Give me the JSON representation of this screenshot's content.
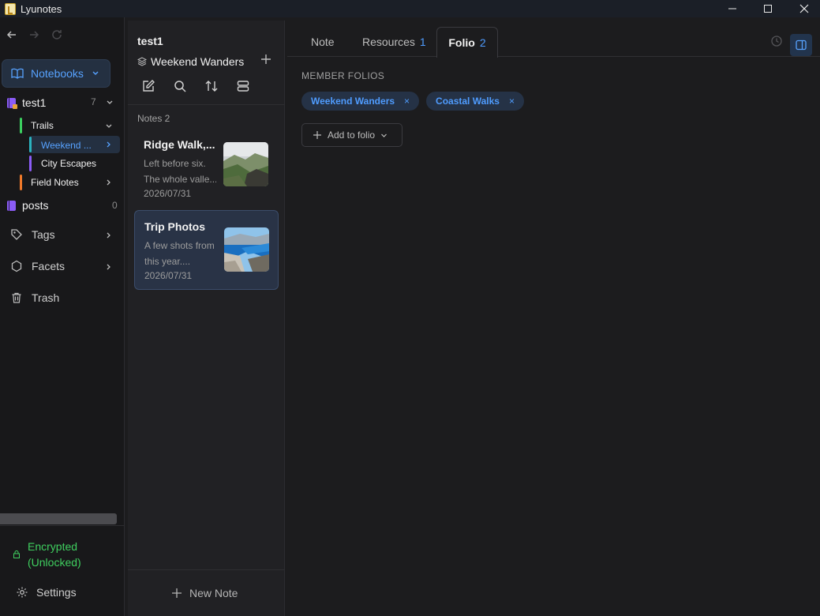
{
  "window": {
    "title": "Lyunotes"
  },
  "sidebar": {
    "notebooks_label": "Notebooks",
    "tree": [
      {
        "label": "test1",
        "count": "7"
      },
      {
        "label": "Trails"
      },
      {
        "label": "Weekend ..."
      },
      {
        "label": "City Escapes"
      },
      {
        "label": "Field Notes"
      },
      {
        "label": "posts",
        "count": "0"
      }
    ],
    "items": [
      {
        "label": "Tags"
      },
      {
        "label": "Facets"
      },
      {
        "label": "Trash"
      }
    ],
    "encrypted_line1": "Encrypted",
    "encrypted_line2": "(Unlocked)",
    "settings_label": "Settings",
    "colors": {
      "accent": "#57a2ff",
      "green": "#3fcf5f",
      "teal": "#2bb3c0",
      "purple": "#8b5cf6",
      "orange": "#f07a2a",
      "lime": "#3ccf5f"
    }
  },
  "notelist": {
    "title": "test1",
    "folio": "Weekend Wanders",
    "notes_label": "Notes 2",
    "notes": [
      {
        "title": "Ridge Walk,...",
        "snippet1": "Left before six.",
        "snippet2": "The whole valle...",
        "date": "2026/07/31"
      },
      {
        "title": "Trip Photos",
        "snippet1": "A few shots from",
        "snippet2": "this year....",
        "date": "2026/07/31"
      }
    ],
    "new_note_label": "New Note"
  },
  "main": {
    "tabs": [
      {
        "label": "Note",
        "count": ""
      },
      {
        "label": "Resources",
        "count": "1"
      },
      {
        "label": "Folio",
        "count": "2"
      }
    ],
    "section_label": "MEMBER FOLIOS",
    "chips": [
      {
        "label": "Weekend Wanders"
      },
      {
        "label": "Coastal Walks"
      }
    ],
    "remove_glyph": "×",
    "add_label": "Add to folio"
  }
}
